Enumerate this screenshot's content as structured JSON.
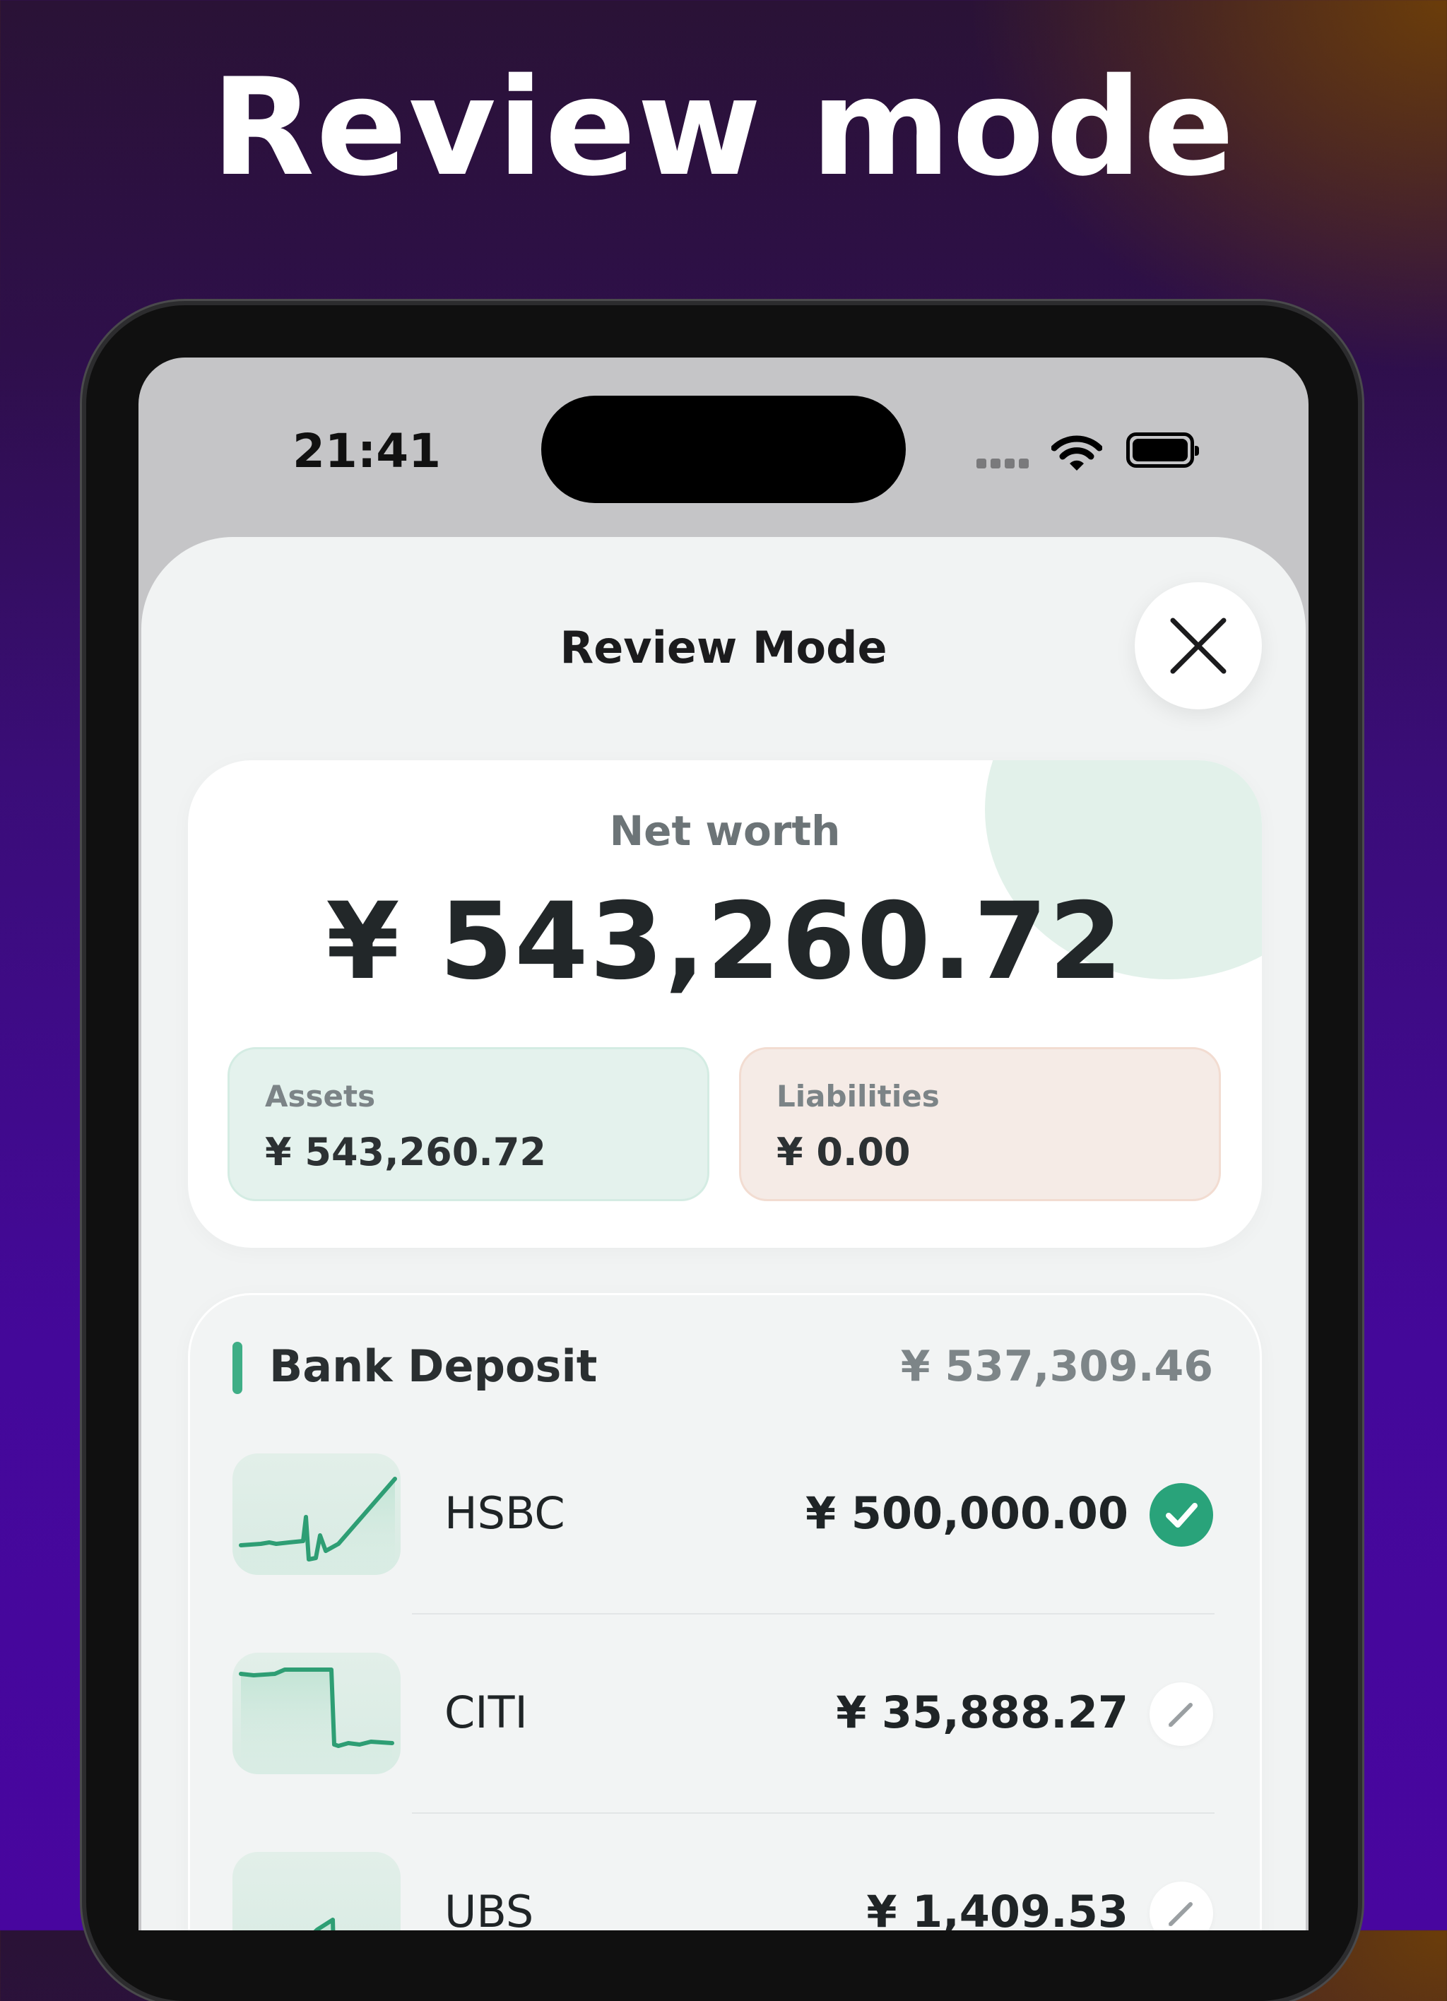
{
  "headline": "Review mode",
  "status_bar": {
    "time": "21:41"
  },
  "sheet": {
    "title": "Review Mode",
    "close_icon": "close-icon"
  },
  "net_worth": {
    "label": "Net worth",
    "value": "¥ 543,260.72",
    "assets": {
      "label": "Assets",
      "value": "¥ 543,260.72"
    },
    "liabilities": {
      "label": "Liabilities",
      "value": "¥ 0.00"
    }
  },
  "bank_deposit": {
    "title": "Bank Deposit",
    "total": "¥ 537,309.46",
    "accent_color": "#3fae86",
    "accounts": [
      {
        "name": "HSBC",
        "amount": "¥ 500,000.00",
        "status": "reviewed",
        "status_icon": "check-circle-icon"
      },
      {
        "name": "CITI",
        "amount": "¥ 35,888.27",
        "status": "edit",
        "status_icon": "pencil-icon"
      },
      {
        "name": "UBS",
        "amount": "¥ 1,409.53",
        "status": "edit",
        "status_icon": "pencil-icon"
      }
    ]
  },
  "colors": {
    "sparkline": "#2e9e74",
    "check": "#29a37a",
    "assets_bg": "#e4f2ed",
    "liabilities_bg": "#f5ebe6"
  }
}
